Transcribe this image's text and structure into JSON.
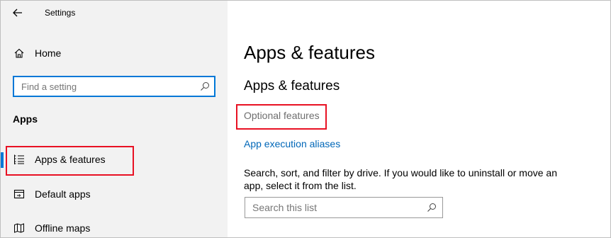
{
  "window": {
    "title": "Settings"
  },
  "sidebar": {
    "home_label": "Home",
    "search": {
      "placeholder": "Find a setting"
    },
    "section_label": "Apps",
    "items": [
      {
        "label": "Apps & features",
        "icon": "list-icon",
        "active": true
      },
      {
        "label": "Default apps",
        "icon": "default-apps-icon",
        "active": false
      },
      {
        "label": "Offline maps",
        "icon": "map-icon",
        "active": false
      }
    ]
  },
  "main": {
    "page_title": "Apps & features",
    "section_title": "Apps & features",
    "optional_features_link": "Optional features",
    "aliases_link": "App execution aliases",
    "description": "Search, sort, and filter by drive. If you would like to uninstall or move an app, select it from the list.",
    "list_search": {
      "placeholder": "Search this list"
    }
  },
  "colors": {
    "accent": "#0078d7",
    "link": "#0067b8",
    "highlight": "#e81123",
    "sidebar_bg": "#f2f2f2"
  }
}
